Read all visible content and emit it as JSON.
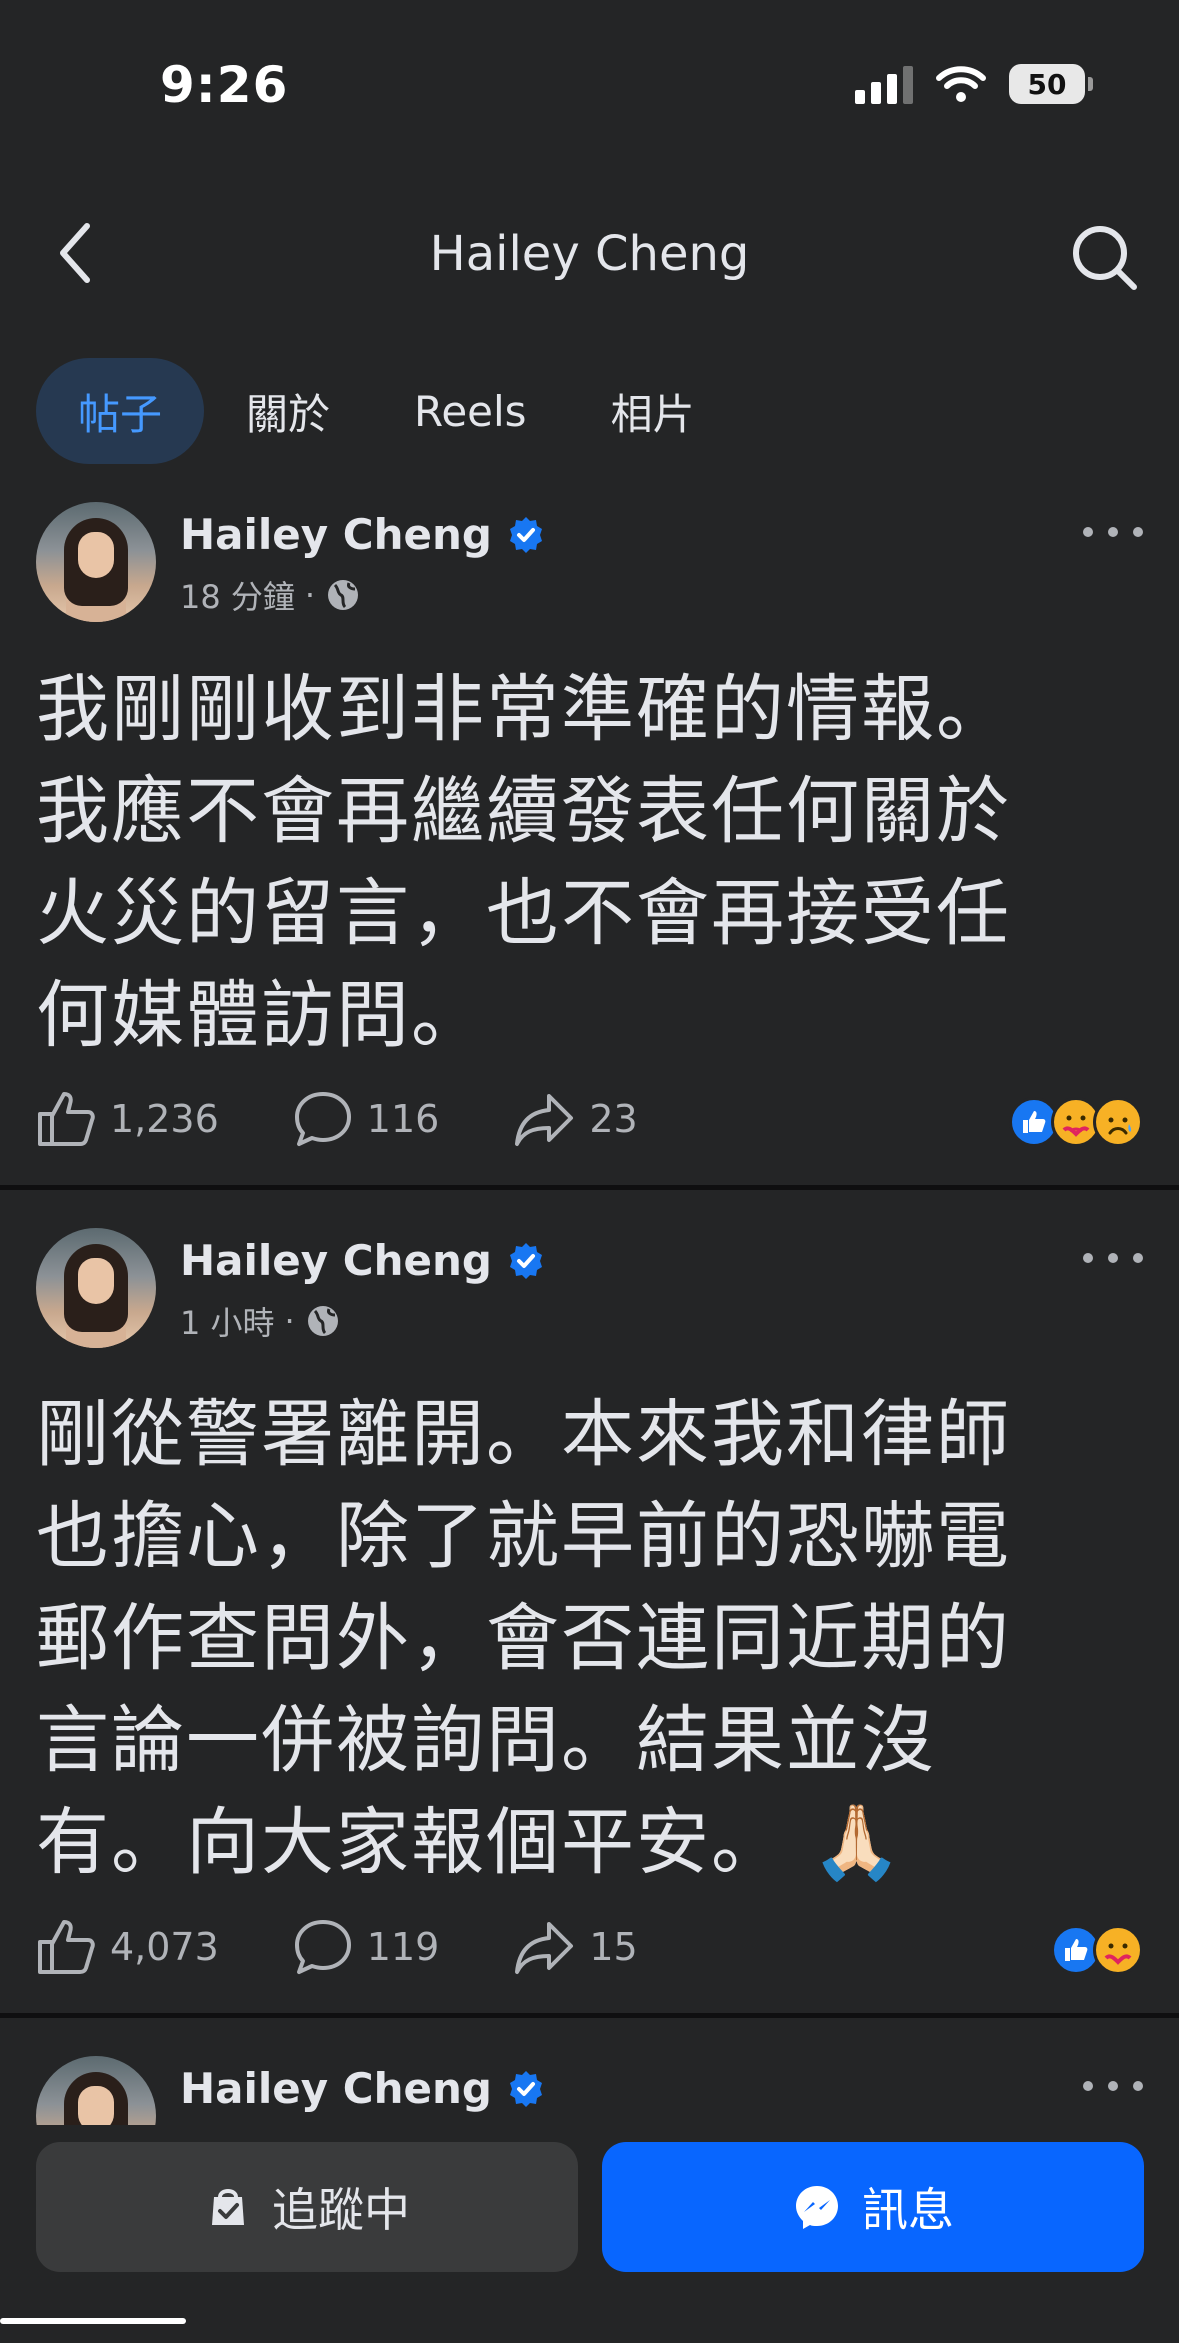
{
  "status_bar": {
    "time": "9:26",
    "battery": "50"
  },
  "header": {
    "title": "Hailey Cheng"
  },
  "tabs": [
    {
      "label": "帖子",
      "active": true
    },
    {
      "label": "關於",
      "active": false
    },
    {
      "label": "Reels",
      "active": false
    },
    {
      "label": "相片",
      "active": false
    }
  ],
  "posts": [
    {
      "author": "Hailey Cheng",
      "time": "18 分鐘",
      "text": "我剛剛收到非常準確的情報。\n我應不會再繼續發表任何關於\n火災的留言，也不會再接受任\n何媒體訪問。",
      "likes": "1,236",
      "comments": "116",
      "shares": "23",
      "reactions": [
        "like-icon",
        "care-icon",
        "sad-icon"
      ]
    },
    {
      "author": "Hailey Cheng",
      "time": "1 小時",
      "text": "剛從警署離開。本來我和律師\n也擔心，除了就早前的恐嚇電\n郵作查問外，會否連同近期的\n言論一併被詢問。結果並沒\n有。向大家報個平安。 🙏🏻",
      "likes": "4,073",
      "comments": "119",
      "shares": "15",
      "reactions": [
        "like-icon",
        "care-icon"
      ]
    },
    {
      "author": "Hailey Cheng"
    }
  ],
  "bottom_bar": {
    "following_label": "追蹤中",
    "message_label": "訊息"
  },
  "colors": {
    "accent": "#0866ff",
    "active_tab_bg": "#263951",
    "active_tab_text": "#4599ff",
    "background": "#242526"
  }
}
